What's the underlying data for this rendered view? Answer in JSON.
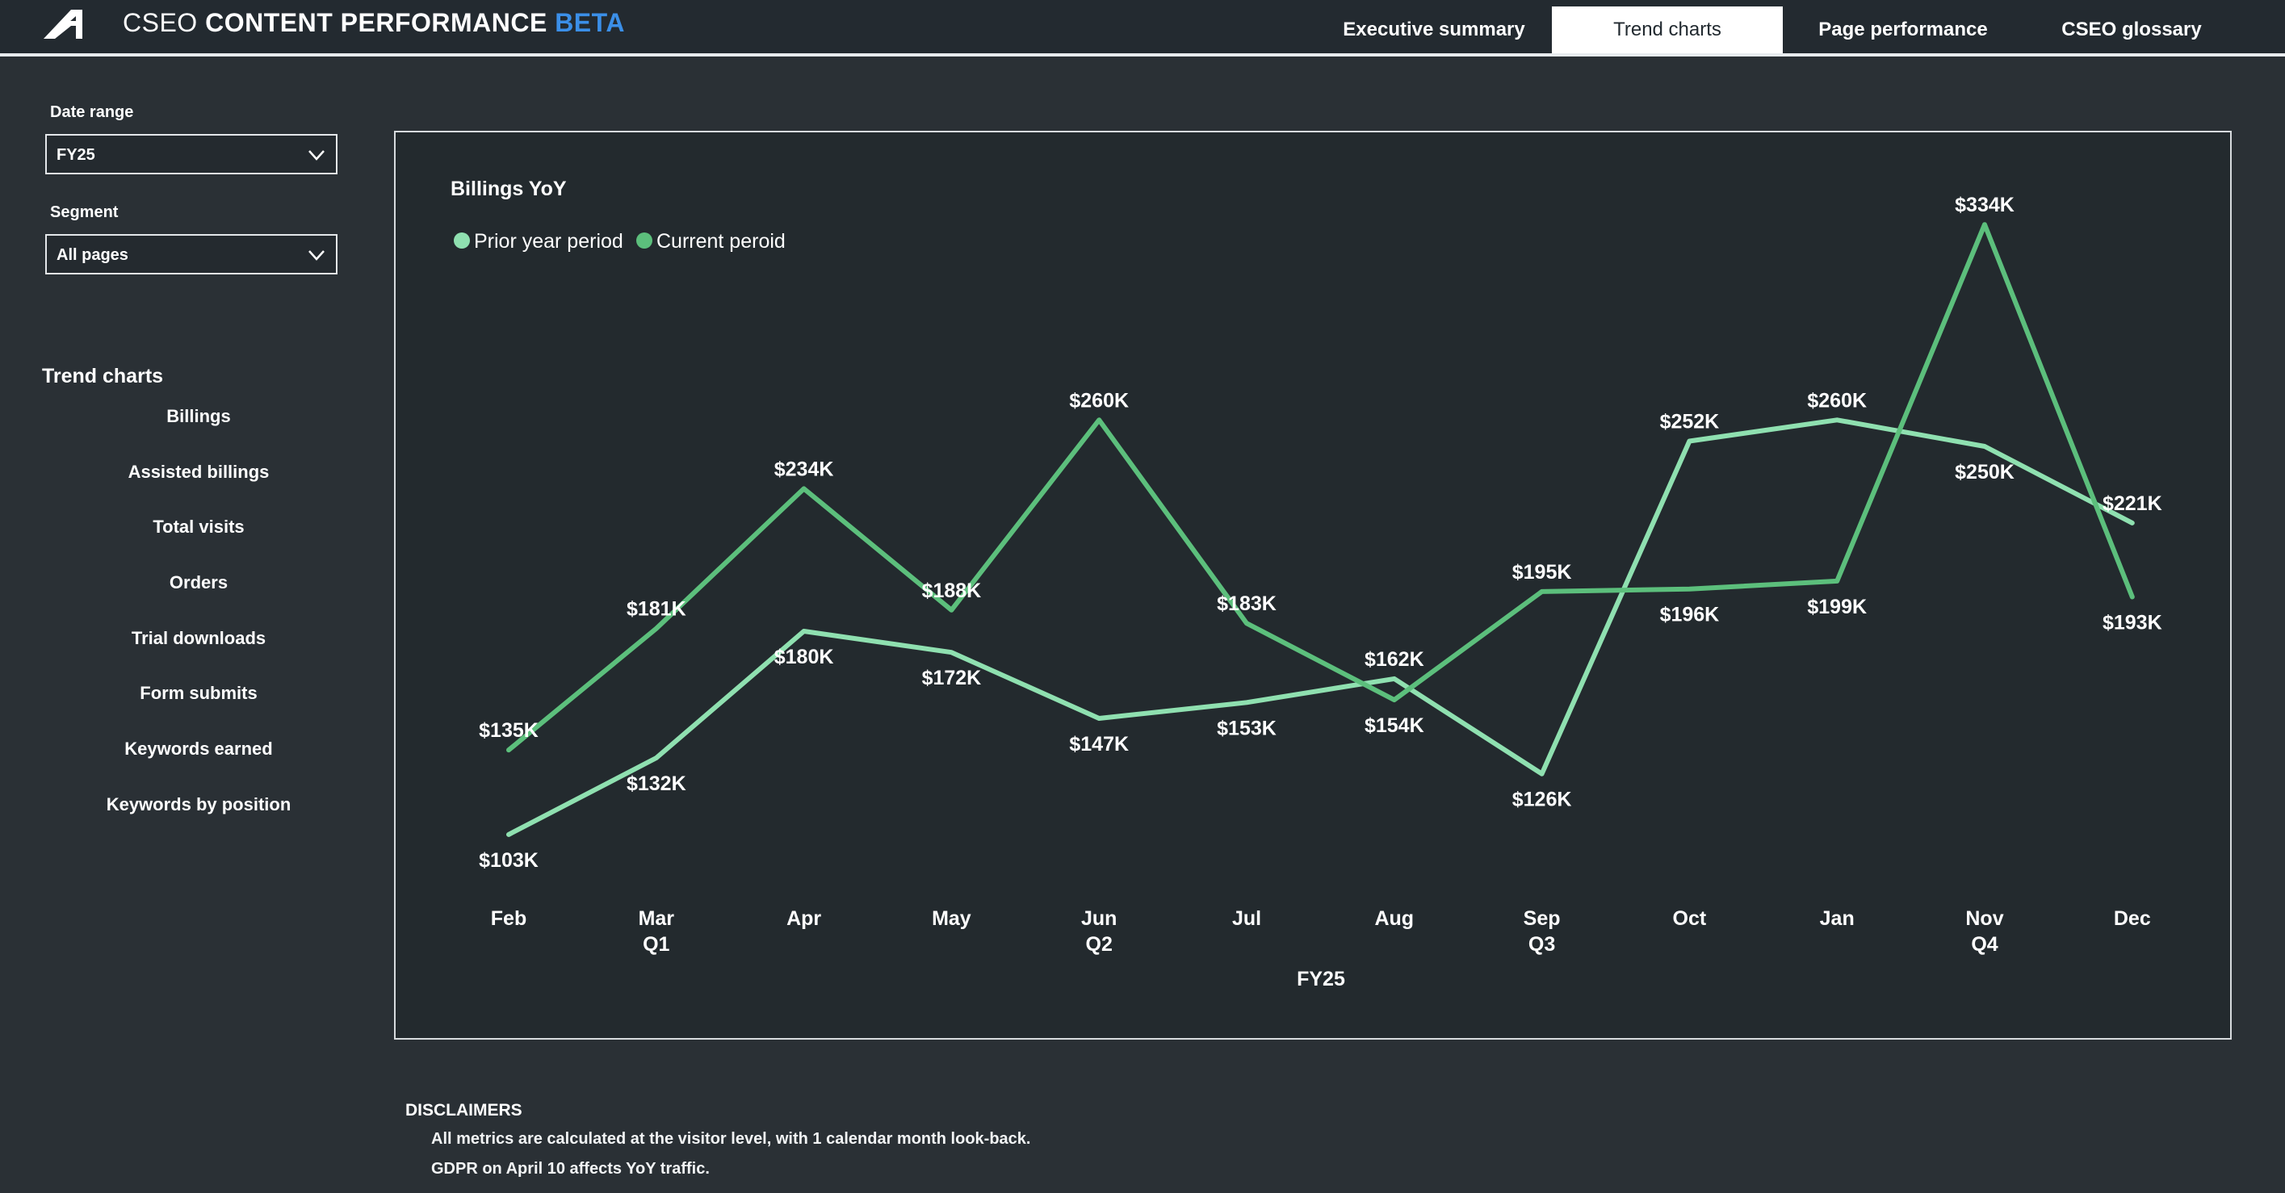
{
  "app": {
    "title_prefix": "CSEO",
    "title_main": "CONTENT PERFORMANCE",
    "title_badge": "BETA",
    "accent": "#3b8fe8"
  },
  "tabs": [
    {
      "label": "Executive summary",
      "active": false
    },
    {
      "label": "Trend charts",
      "active": true
    },
    {
      "label": "Page performance",
      "active": false
    },
    {
      "label": "CSEO glossary",
      "active": false
    }
  ],
  "filters": {
    "date_range": {
      "label": "Date range",
      "value": "FY25",
      "icon": "chevron-down-icon"
    },
    "segment": {
      "label": "Segment",
      "value": "All pages",
      "icon": "chevron-down-icon"
    }
  },
  "nav": {
    "heading": "Trend charts",
    "items": [
      "Billings",
      "Assisted billings",
      "Total visits",
      "Orders",
      "Trial downloads",
      "Form submits",
      "Keywords earned",
      "Keywords by position"
    ]
  },
  "chart_data": {
    "type": "line",
    "title": "Billings YoY",
    "xlabel": "FY25",
    "ylabel": "",
    "categories": [
      "Feb",
      "Mar",
      "Apr",
      "May",
      "Jun",
      "Jul",
      "Aug",
      "Sep",
      "Oct",
      "Jan",
      "Nov",
      "Dec"
    ],
    "quarter_labels": [
      "",
      "Q1",
      "",
      "",
      "Q2",
      "",
      "",
      "Q3",
      "",
      "",
      "Q4",
      ""
    ],
    "legend_position": "top-left",
    "grid": false,
    "series": [
      {
        "name": "Prior year period",
        "color": "#8fe0b0",
        "values": [
          103,
          132,
          180,
          172,
          147,
          153,
          162,
          126,
          252,
          260,
          250,
          221
        ],
        "labels": [
          "$103K",
          "$132K",
          "$180K",
          "$172K",
          "$147K",
          "$153K",
          "$162K",
          "$126K",
          "$252K",
          "$260K",
          "$250K",
          "$221K"
        ]
      },
      {
        "name": "Current peroid",
        "color": "#5cbf7c",
        "values": [
          135,
          181,
          234,
          188,
          260,
          183,
          154,
          195,
          196,
          199,
          334,
          193
        ],
        "labels": [
          "$135K",
          "$181K",
          "$234K",
          "$188K",
          "$260K",
          "$183K",
          "$154K",
          "$195K",
          "$196K",
          "$199K",
          "$334K",
          "$193K"
        ]
      }
    ]
  },
  "disclaimers": {
    "title": "DISCLAIMERS",
    "lines": [
      "All metrics are calculated at the visitor level, with 1 calendar month look-back.",
      "GDPR on April 10 affects YoY traffic."
    ]
  }
}
